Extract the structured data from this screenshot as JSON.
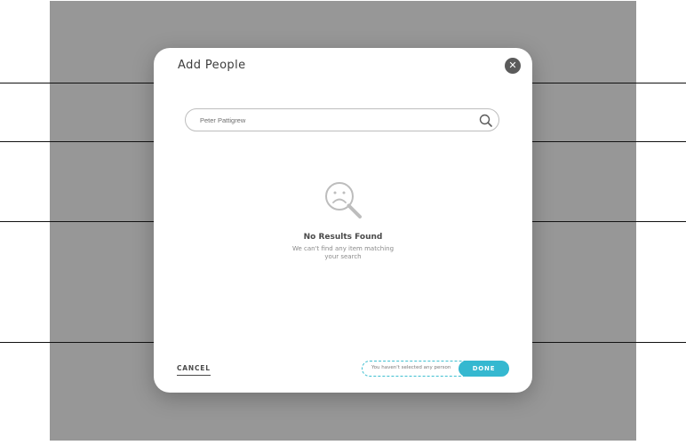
{
  "modal": {
    "title": "Add People",
    "close_icon": "close-icon"
  },
  "search": {
    "value": "Peter Pattigrew",
    "placeholder": "",
    "icon": "search-icon"
  },
  "empty_state": {
    "icon": "sad-magnifier-icon",
    "title": "No Results Found",
    "message": "We can't find any item matching your search"
  },
  "footer": {
    "cancel_label": "CANCEL",
    "selection_status": "You haven't selected any person",
    "done_label": "DONE"
  },
  "colors": {
    "backdrop": "#979797",
    "accent": "#35b8d0",
    "close_button": "#5b5b5b"
  }
}
